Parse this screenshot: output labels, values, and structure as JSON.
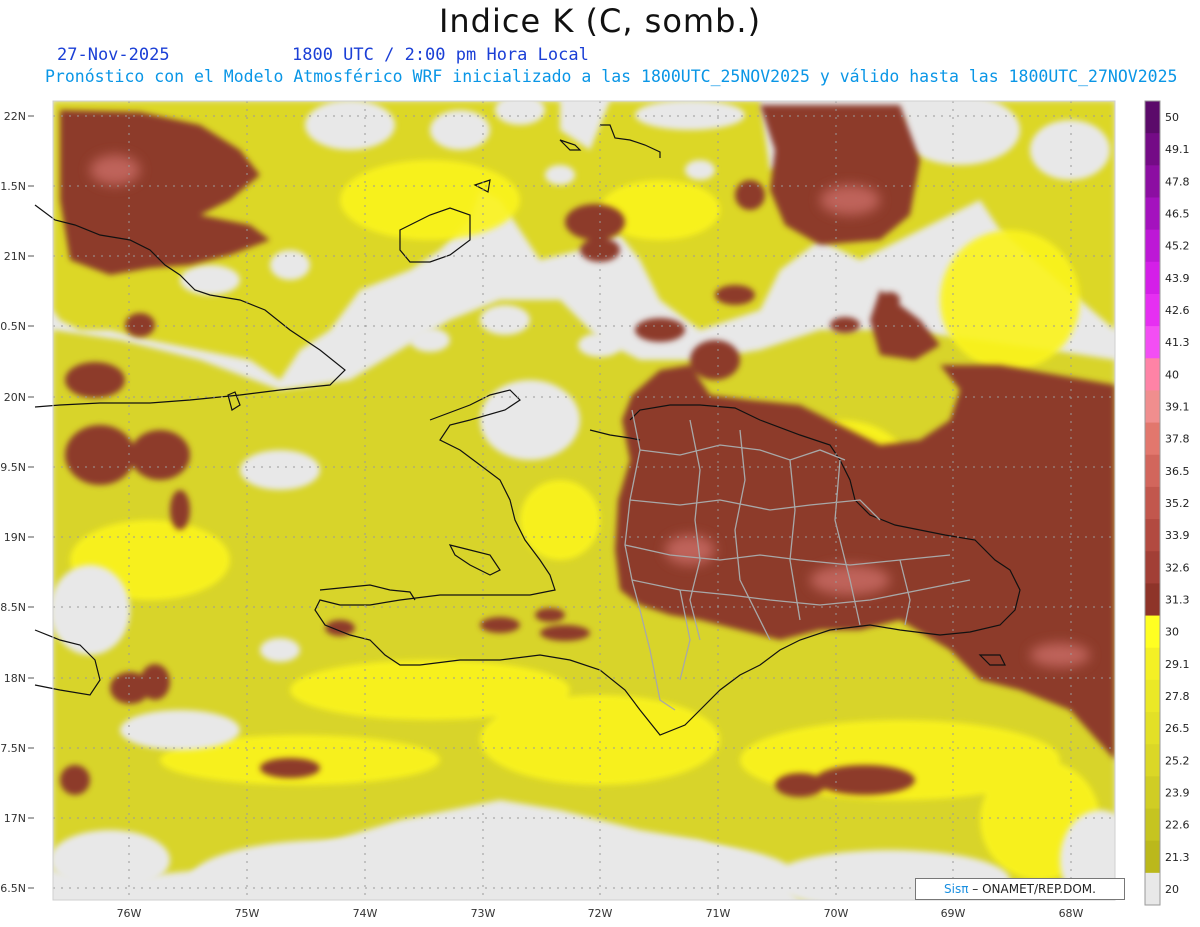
{
  "header": {
    "title": "Indice K (C, somb.)",
    "date": "27-Nov-2025",
    "time": "1800 UTC / 2:00 pm Hora Local",
    "subtitle": "Pronóstico con el Modelo Atmosférico WRF inicializado a las 1800UTC_25NOV2025 y válido hasta las  1800UTC_27NOV2025"
  },
  "map": {
    "lat_labels": [
      "22N",
      "1.5N",
      "21N",
      "0.5N",
      "20N",
      "9.5N",
      "19N",
      "8.5N",
      "18N",
      "7.5N",
      "17N",
      "6.5N"
    ],
    "lon_labels": [
      "76W",
      "75W",
      "74W",
      "73W",
      "72W",
      "71W",
      "70W",
      "69W",
      "68W"
    ],
    "lat_range": [
      16.5,
      22
    ],
    "lon_range": [
      -76.6,
      -67.6
    ]
  },
  "colorbar": {
    "levels": [
      "50",
      "49.1",
      "47.8",
      "46.5",
      "45.2",
      "43.9",
      "42.6",
      "41.3",
      "40",
      "39.1",
      "37.8",
      "36.5",
      "35.2",
      "33.9",
      "32.6",
      "31.3",
      "30",
      "29.1",
      "27.8",
      "26.5",
      "25.2",
      "23.9",
      "22.6",
      "21.3",
      "20"
    ],
    "colors": [
      "#5b0a6a",
      "#740b86",
      "#8c0ea2",
      "#a412be",
      "#bd18d6",
      "#d41fe8",
      "#e62ff2",
      "#f34ef4",
      "#ff83a6",
      "#f08e8e",
      "#e2776d",
      "#d2665c",
      "#c2574d",
      "#b24a40",
      "#a23f36",
      "#8e3429",
      "#ffff22",
      "#f4f025",
      "#ebe826",
      "#e3e026",
      "#dbd726",
      "#d0cd24",
      "#c6c420",
      "#bbb81b",
      "#e8e8e8"
    ]
  },
  "credit": {
    "sis": "Sisπ",
    "text": "– ONAMET/REP.DOM."
  },
  "colors": {
    "land_ok": "#e3df25",
    "dark": "#8d3a2c",
    "sea_gap": "#e8e8e8"
  }
}
